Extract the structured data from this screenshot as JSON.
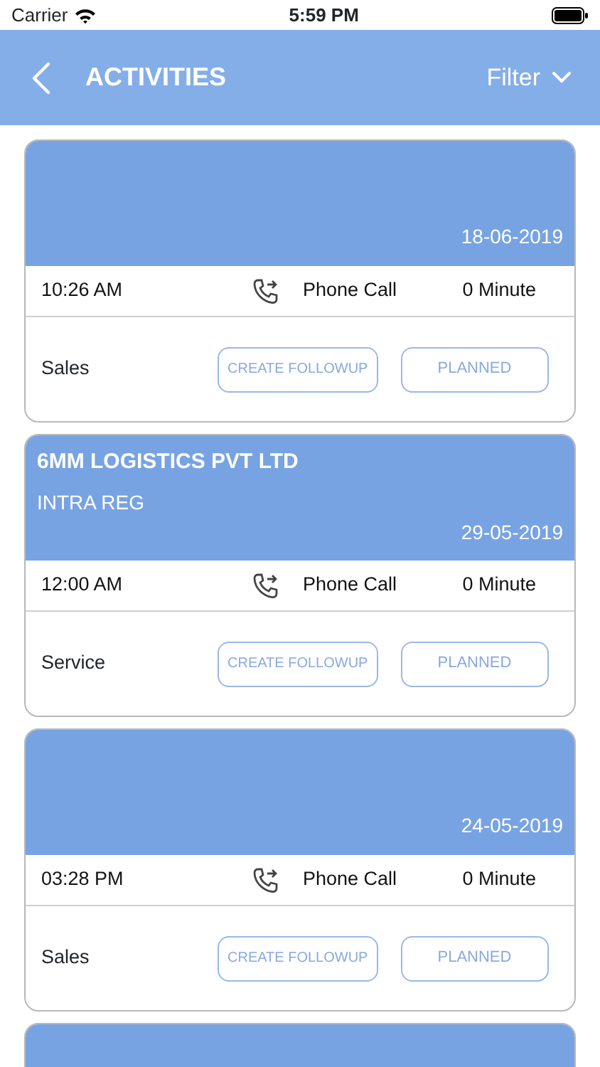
{
  "status_bar": {
    "carrier": "Carrier",
    "time": "5:59 PM"
  },
  "header": {
    "title": "ACTIVITIES",
    "filter": "Filter"
  },
  "activities": [
    {
      "kind": "full",
      "date": "18-06-2019",
      "time": "10:26 AM",
      "type": "Phone Call",
      "duration": "0 Minute",
      "category": "Sales",
      "followup": "CREATE FOLLOWUP",
      "status": "PLANNED"
    },
    {
      "kind": "full",
      "company": "6MM LOGISTICS PVT LTD",
      "subtitle": "INTRA REG",
      "date": "29-05-2019",
      "time": "12:00 AM",
      "type": "Phone Call",
      "duration": "0 Minute",
      "category": "Service",
      "followup": "CREATE FOLLOWUP",
      "status": "PLANNED"
    },
    {
      "kind": "full",
      "date": "24-05-2019",
      "time": "03:28 PM",
      "type": "Phone Call",
      "duration": "0 Minute",
      "category": "Sales",
      "followup": "CREATE FOLLOWUP",
      "status": "PLANNED"
    },
    {
      "kind": "partial"
    }
  ]
}
